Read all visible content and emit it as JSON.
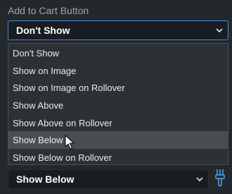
{
  "field": {
    "label": "Add to Cart Button",
    "selected": "Don't Show"
  },
  "dropdown": {
    "options": [
      "Don't Show",
      "Show on Image",
      "Show on Image on Rollover",
      "Show Above",
      "Show Above on Rollover",
      "Show Below",
      "Show Below on Rollover"
    ],
    "hovered_index": 5
  },
  "second_field": {
    "selected": "Show Below"
  },
  "icons": {
    "chevron": "chevron-down-icon",
    "brush": "paint-brush-icon",
    "cursor": "mouse-pointer-icon"
  },
  "colors": {
    "background": "#23282d",
    "focus_border": "#3a8fd9",
    "hover_row": "#4a4e53",
    "brush": "#4a9fe8"
  }
}
